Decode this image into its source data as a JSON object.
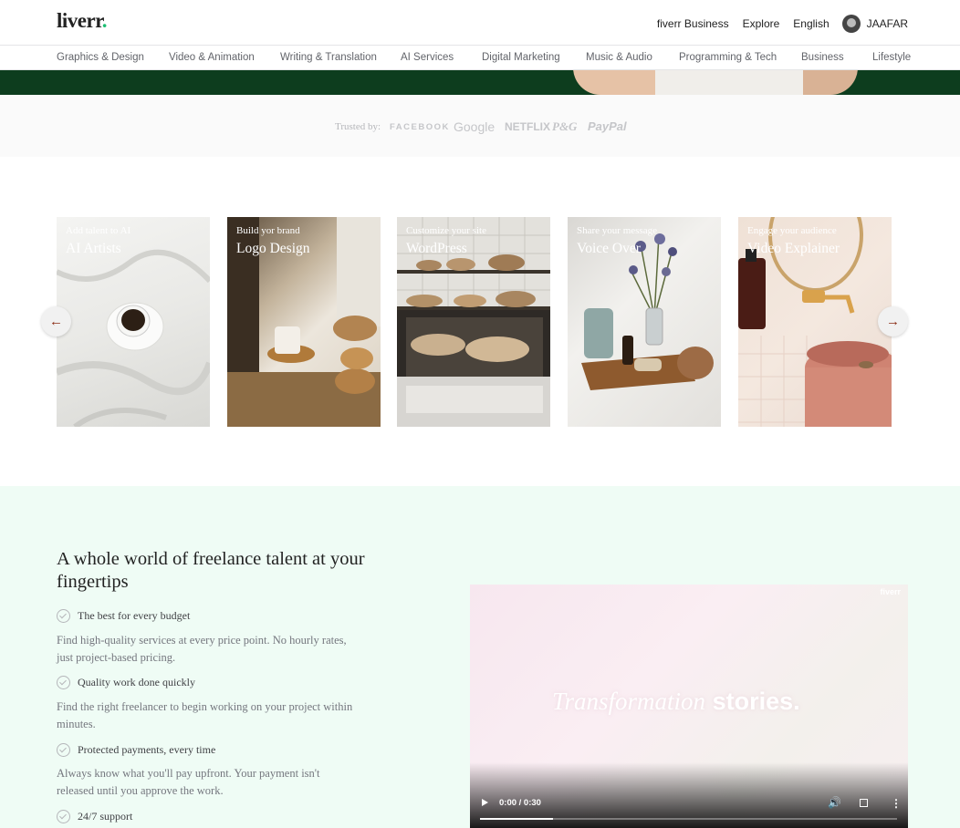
{
  "header": {
    "logo_text": "liverr",
    "logo_dot": ".",
    "links": [
      "fiverr Business",
      "Explore",
      "English"
    ],
    "user_name": "JAAFAR"
  },
  "categories": [
    "Graphics & Design",
    "Video & Animation",
    "Writing & Translation",
    "AI Services",
    "Digital Marketing",
    "Music & Audio",
    "Programming & Tech",
    "Business",
    "Lifestyle"
  ],
  "trusted": {
    "label": "Trusted by:",
    "brands": [
      "FACEBOOK",
      "Google",
      "NETFLIX",
      "P&G",
      "PayPal"
    ]
  },
  "cards": [
    {
      "subtitle": "Add talent to AI",
      "title": "AI Artists"
    },
    {
      "subtitle": "Build yor brand",
      "title": "Logo Design"
    },
    {
      "subtitle": "Customize your site",
      "title": "WordPress"
    },
    {
      "subtitle": "Share your message",
      "title": "Voice Over"
    },
    {
      "subtitle": "Engage your audience",
      "title": "Video Explainer"
    }
  ],
  "arrows": {
    "prev": "←",
    "next": "→"
  },
  "section": {
    "title": "A whole world of freelance talent at your fingertips",
    "features": [
      {
        "title": "The best for every budget",
        "desc": "Find high-quality services at every price point. No hourly rates, just project-based pricing."
      },
      {
        "title": "Quality work done quickly",
        "desc": "Find the right freelancer to begin working on your project within minutes."
      },
      {
        "title": "Protected payments, every time",
        "desc": "Always know what you'll pay upfront. Your payment isn't released until you approve the work."
      },
      {
        "title": "24/7 support",
        "desc": ""
      }
    ]
  },
  "video": {
    "title_italic": "Transformation",
    "title_bold": "stories.",
    "watermark": "fiverr",
    "time": "0:00 / 0:30",
    "progress": 0
  },
  "colors": {
    "brand_green": "#1dbf73",
    "hero_green": "#0d3d1e",
    "arrow_color": "#8a2b14",
    "section_bg": "#effcf5"
  }
}
